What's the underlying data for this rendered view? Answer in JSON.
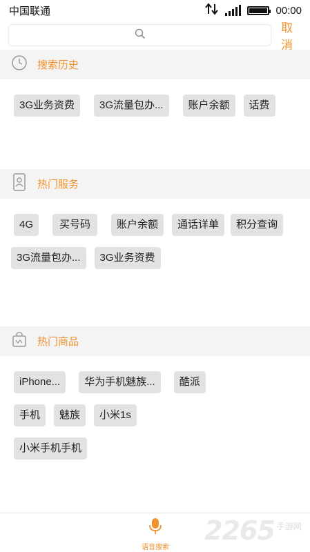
{
  "status_bar": {
    "carrier": "中国联通",
    "time": "00:00",
    "signal_bars": 5,
    "battery_level": 1.0
  },
  "search": {
    "placeholder": "",
    "cancel_label": "取消"
  },
  "sections": {
    "history": {
      "title": "搜索历史",
      "icon": "clock-icon",
      "items": [
        "3G业务资费",
        "3G流量包办...",
        "账户余额",
        "话费"
      ]
    },
    "services": {
      "title": "热门服务",
      "icon": "phone-card-icon",
      "items": [
        "4G",
        "买号码",
        "账户余额",
        "通话详单",
        "积分查询",
        "3G流量包办...",
        "3G业务资费"
      ]
    },
    "products": {
      "title": "热门商品",
      "icon": "shopping-bag-icon",
      "items": [
        "iPhone...",
        "华为手机魅族...",
        "酷派",
        "手机",
        "魅族",
        "小米1s",
        "小米手机手机"
      ]
    }
  },
  "bottom_bar": {
    "voice_label": "语音搜索"
  },
  "watermark": {
    "number": "2265",
    "site": "手游网"
  },
  "colors": {
    "accent": "#f0922d",
    "section_bg": "#f4f4f4",
    "chip_bg": "#e2e2e2"
  }
}
